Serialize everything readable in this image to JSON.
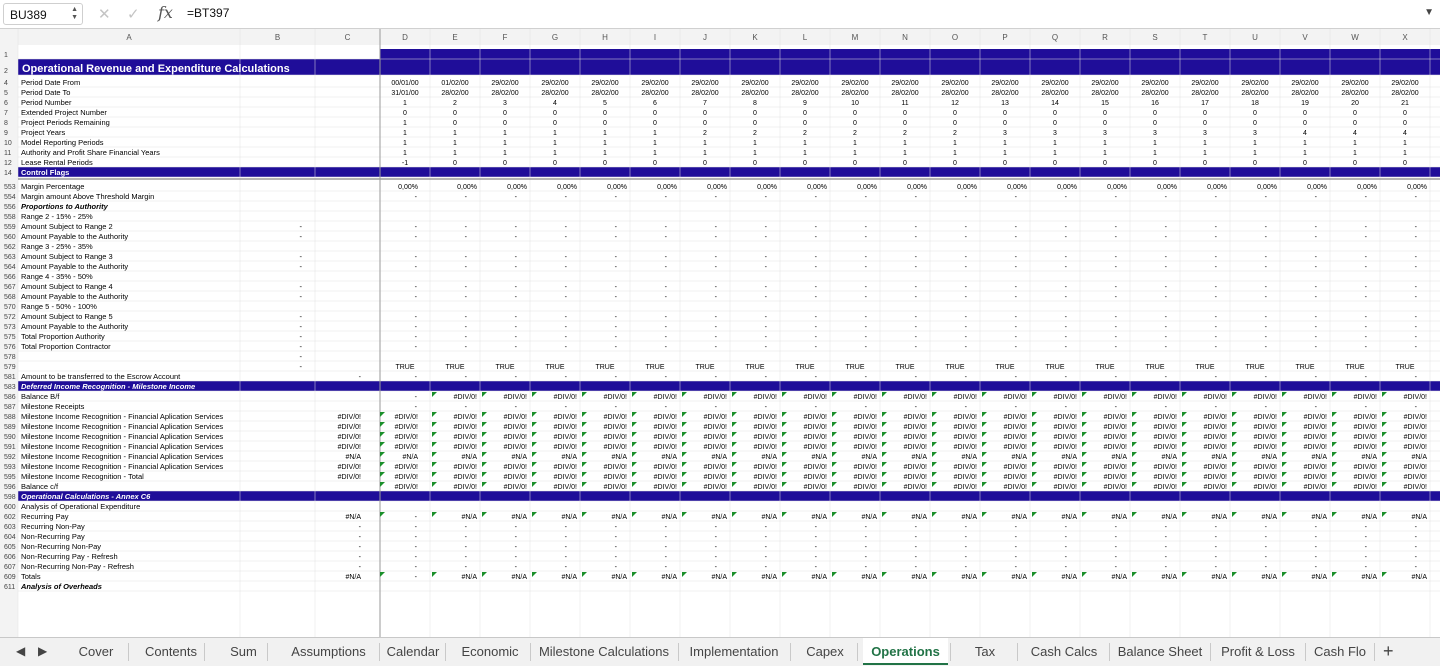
{
  "formula_bar": {
    "name_box": "BU389",
    "cancel_icon": "x-icon",
    "enter_icon": "check-icon",
    "fx_label": "fx",
    "formula": "=BT397"
  },
  "grid": {
    "columns": [
      "A",
      "B",
      "C",
      "D",
      "E",
      "F",
      "G",
      "H",
      "I",
      "J",
      "K",
      "L",
      "M",
      "N",
      "O",
      "P",
      "Q",
      "R",
      "S",
      "T",
      "U",
      "V",
      "W",
      "X"
    ],
    "frozen_rows": [
      {
        "n": "1",
        "label": "",
        "type": "blank"
      },
      {
        "n": "2",
        "label": "Operational Revenue and Expenditure Calculations",
        "type": "title"
      },
      {
        "n": "4",
        "label": "Period Date From",
        "type": "data",
        "c": "",
        "d": "00/01/00",
        "vals": [
          "01/02/00",
          "29/02/00",
          "29/02/00",
          "29/02/00",
          "29/02/00",
          "29/02/00",
          "29/02/00",
          "29/02/00",
          "29/02/00",
          "29/02/00",
          "29/02/00",
          "29/02/00",
          "29/02/00",
          "29/02/00",
          "29/02/00",
          "29/02/00",
          "29/02/00",
          "29/02/00",
          "29/02/00",
          "29/02/00"
        ]
      },
      {
        "n": "5",
        "label": "Period Date To",
        "type": "data",
        "c": "",
        "d": "31/01/00",
        "vals": [
          "28/02/00",
          "28/02/00",
          "28/02/00",
          "28/02/00",
          "28/02/00",
          "28/02/00",
          "28/02/00",
          "28/02/00",
          "28/02/00",
          "28/02/00",
          "28/02/00",
          "28/02/00",
          "28/02/00",
          "28/02/00",
          "28/02/00",
          "28/02/00",
          "28/02/00",
          "28/02/00",
          "28/02/00",
          "28/02/00"
        ]
      },
      {
        "n": "6",
        "label": "Period Number",
        "type": "data",
        "c": "",
        "d": "1",
        "vals": [
          "2",
          "3",
          "4",
          "5",
          "6",
          "7",
          "8",
          "9",
          "10",
          "11",
          "12",
          "13",
          "14",
          "15",
          "16",
          "17",
          "18",
          "19",
          "20",
          "21"
        ]
      },
      {
        "n": "7",
        "label": "Extended Project Number",
        "type": "data",
        "c": "",
        "d": "0",
        "vals": [
          "0",
          "0",
          "0",
          "0",
          "0",
          "0",
          "0",
          "0",
          "0",
          "0",
          "0",
          "0",
          "0",
          "0",
          "0",
          "0",
          "0",
          "0",
          "0",
          "0"
        ]
      },
      {
        "n": "8",
        "label": "Project Periods Remaining",
        "type": "data",
        "c": "",
        "d": "1",
        "vals": [
          "0",
          "0",
          "0",
          "0",
          "0",
          "0",
          "0",
          "0",
          "0",
          "0",
          "0",
          "0",
          "0",
          "0",
          "0",
          "0",
          "0",
          "0",
          "0",
          "0"
        ]
      },
      {
        "n": "9",
        "label": "Project Years",
        "type": "data",
        "c": "",
        "d": "1",
        "vals": [
          "1",
          "1",
          "1",
          "1",
          "1",
          "2",
          "2",
          "2",
          "2",
          "2",
          "2",
          "3",
          "3",
          "3",
          "3",
          "3",
          "3",
          "4",
          "4",
          "4"
        ]
      },
      {
        "n": "10",
        "label": "Model Reporting Periods",
        "type": "data",
        "c": "",
        "d": "1",
        "vals": [
          "1",
          "1",
          "1",
          "1",
          "1",
          "1",
          "1",
          "1",
          "1",
          "1",
          "1",
          "1",
          "1",
          "1",
          "1",
          "1",
          "1",
          "1",
          "1",
          "1"
        ]
      },
      {
        "n": "11",
        "label": "Authority and Profit Share Financial Years",
        "type": "data",
        "c": "",
        "d": "1",
        "vals": [
          "1",
          "1",
          "1",
          "1",
          "1",
          "1",
          "1",
          "1",
          "1",
          "1",
          "1",
          "1",
          "1",
          "1",
          "1",
          "1",
          "1",
          "1",
          "1",
          "1"
        ]
      },
      {
        "n": "12",
        "label": "Lease Rental Periods",
        "type": "data",
        "c": "",
        "d": "-1",
        "vals": [
          "0",
          "0",
          "0",
          "0",
          "0",
          "0",
          "0",
          "0",
          "0",
          "0",
          "0",
          "0",
          "0",
          "0",
          "0",
          "0",
          "0",
          "0",
          "0",
          "0"
        ]
      },
      {
        "n": "14",
        "label": "Control Flags",
        "type": "section"
      }
    ],
    "scroll_rows": [
      {
        "n": "553",
        "label": "Margin Percentage",
        "b": "",
        "c": "",
        "d": "0,00%",
        "fill": "0,00%",
        "tri": false
      },
      {
        "n": "554",
        "label": "Margin amount Above Threshold Margin",
        "b": "",
        "c": "",
        "d": "-",
        "fill": "-",
        "tri": false
      },
      {
        "n": "556",
        "label": "Proportions to Authority",
        "type": "bi",
        "fill": ""
      },
      {
        "n": "558",
        "label": "Range 2 - 15% - 25%",
        "b": "",
        "c": "",
        "d": "",
        "fill": "",
        "tri": false
      },
      {
        "n": "559",
        "label": "Amount Subject to Range 2",
        "b": "-",
        "c": "",
        "d": "-",
        "fill": "-",
        "tri": false
      },
      {
        "n": "560",
        "label": "Amount Payable to the Authority",
        "b": "-",
        "c": "",
        "d": "-",
        "fill": "-",
        "tri": false
      },
      {
        "n": "562",
        "label": "Range 3 - 25% - 35%",
        "b": "",
        "c": "",
        "d": "",
        "fill": "",
        "tri": false
      },
      {
        "n": "563",
        "label": "Amount Subject to Range 3",
        "b": "-",
        "c": "",
        "d": "-",
        "fill": "-",
        "tri": false
      },
      {
        "n": "564",
        "label": "Amount Payable to the Authority",
        "b": "-",
        "c": "",
        "d": "-",
        "fill": "-",
        "tri": false
      },
      {
        "n": "566",
        "label": "Range 4 - 35% - 50%",
        "b": "",
        "c": "",
        "d": "",
        "fill": "",
        "tri": false
      },
      {
        "n": "567",
        "label": "Amount Subject to Range 4",
        "b": "-",
        "c": "",
        "d": "-",
        "fill": "-",
        "tri": false
      },
      {
        "n": "568",
        "label": "Amount Payable to the Authority",
        "b": "-",
        "c": "",
        "d": "-",
        "fill": "-",
        "tri": false
      },
      {
        "n": "570",
        "label": "Range 5 - 50% - 100%",
        "b": "",
        "c": "",
        "d": "",
        "fill": "",
        "tri": false
      },
      {
        "n": "572",
        "label": "Amount Subject to Range 5",
        "b": "-",
        "c": "",
        "d": "-",
        "fill": "-",
        "tri": false
      },
      {
        "n": "573",
        "label": "Amount Payable to the Authority",
        "b": "-",
        "c": "",
        "d": "-",
        "fill": "-",
        "tri": false
      },
      {
        "n": "575",
        "label": "Total Proportion Authority",
        "b": "-",
        "c": "",
        "d": "-",
        "fill": "-",
        "tri": false
      },
      {
        "n": "576",
        "label": "Total Proportion Contractor",
        "b": "-",
        "c": "",
        "d": "-",
        "fill": "-",
        "tri": false
      },
      {
        "n": "578",
        "label": "",
        "b": "-",
        "c": "",
        "d": "",
        "fill": "",
        "tri": false
      },
      {
        "n": "579",
        "label": "",
        "b": "-",
        "c": "",
        "d": "TRUE",
        "fill": "TRUE",
        "tri": false
      },
      {
        "n": "581",
        "label": "Amount to be transferred to the Escrow Account",
        "b": "",
        "c": "-",
        "d": "-",
        "fill": "-",
        "tri": false
      },
      {
        "n": "583",
        "label": "Deferred Income Recognition - Milestone Income",
        "type": "section"
      },
      {
        "n": "586",
        "label": "Balance B/f",
        "b": "",
        "c": "",
        "d": "-",
        "fill": "#DIV/0!",
        "tri": true
      },
      {
        "n": "587",
        "label": "Milestone Receipts",
        "b": "",
        "c": "",
        "d": "-",
        "fill": "-",
        "tri": false
      },
      {
        "n": "588",
        "label": "Milestone Income Recognition - Financial Aplication Services",
        "b": "",
        "c": "#DIV/0!",
        "d": "#DIV/0!",
        "fill": "#DIV/0!",
        "tri": true
      },
      {
        "n": "589",
        "label": "Milestone Income Recognition - Financial Aplication Services",
        "b": "",
        "c": "#DIV/0!",
        "d": "#DIV/0!",
        "fill": "#DIV/0!",
        "tri": true
      },
      {
        "n": "590",
        "label": "Milestone Income Recognition - Financial Aplication Services",
        "b": "",
        "c": "#DIV/0!",
        "d": "#DIV/0!",
        "fill": "#DIV/0!",
        "tri": true
      },
      {
        "n": "591",
        "label": "Milestone Income Recognition - Financial Aplication Services",
        "b": "",
        "c": "#DIV/0!",
        "d": "#DIV/0!",
        "fill": "#DIV/0!",
        "tri": true
      },
      {
        "n": "592",
        "label": "Milestone Income Recognition - Financial Aplication Services",
        "b": "",
        "c": "#N/A",
        "d": "#N/A",
        "fill": "#N/A",
        "tri": true
      },
      {
        "n": "593",
        "label": "Milestone Income Recognition - Financial Aplication Services",
        "b": "",
        "c": "#DIV/0!",
        "d": "#DIV/0!",
        "fill": "#DIV/0!",
        "tri": true
      },
      {
        "n": "595",
        "label": "Milestone Income Recognition - Total",
        "b": "",
        "c": "#DIV/0!",
        "d": "#DIV/0!",
        "fill": "#DIV/0!",
        "tri": true
      },
      {
        "n": "596",
        "label": "Balance c/f",
        "b": "",
        "c": "",
        "d": "#DIV/0!",
        "fill": "#DIV/0!",
        "tri": true
      },
      {
        "n": "598",
        "label": "Operational Calculations - Annex C6",
        "type": "section"
      },
      {
        "n": "600",
        "label": "Analysis of Operational Expenditure",
        "b": "",
        "c": "",
        "d": "",
        "fill": "",
        "tri": false
      },
      {
        "n": "602",
        "label": "Recurring Pay",
        "b": "",
        "c": "#N/A",
        "d": "-",
        "fill": "#N/A",
        "tri": true
      },
      {
        "n": "603",
        "label": "Recurring Non-Pay",
        "b": "",
        "c": "-",
        "d": "-",
        "fill": "-",
        "tri": false
      },
      {
        "n": "604",
        "label": "Non-Recurring Pay",
        "b": "",
        "c": "-",
        "d": "-",
        "fill": "-",
        "tri": false
      },
      {
        "n": "605",
        "label": "Non-Recurring Non-Pay",
        "b": "",
        "c": "-",
        "d": "-",
        "fill": "-",
        "tri": false
      },
      {
        "n": "606",
        "label": "Non-Recurring Pay - Refresh",
        "b": "",
        "c": "-",
        "d": "-",
        "fill": "-",
        "tri": false
      },
      {
        "n": "607",
        "label": "Non-Recurring Non-Pay - Refresh",
        "b": "",
        "c": "-",
        "d": "-",
        "fill": "-",
        "tri": false
      },
      {
        "n": "609",
        "label": "Totals",
        "b": "",
        "c": "#N/A",
        "d": "-",
        "fill": "#N/A",
        "tri": true
      },
      {
        "n": "611",
        "label": "Analysis of Overheads",
        "type": "bi",
        "fill": ""
      }
    ]
  },
  "sheet_tabs": [
    "Cover",
    "Contents",
    "Sum",
    "Assumptions",
    "Calendar",
    "Economic",
    "Milestone Calculations",
    "Implementation",
    "Capex",
    "Operations",
    "Tax",
    "Cash Calcs",
    "Balance Sheet",
    "Profit & Loss",
    "Cash Flo"
  ],
  "active_tab": "Operations",
  "add_sheet_label": "+",
  "colors": {
    "section_bg": "#1f0d99",
    "section_text": "#ffffff",
    "active_tab": "#217346",
    "gridline": "#e2e2e2",
    "comment_triangle": "#1a8f2a"
  }
}
